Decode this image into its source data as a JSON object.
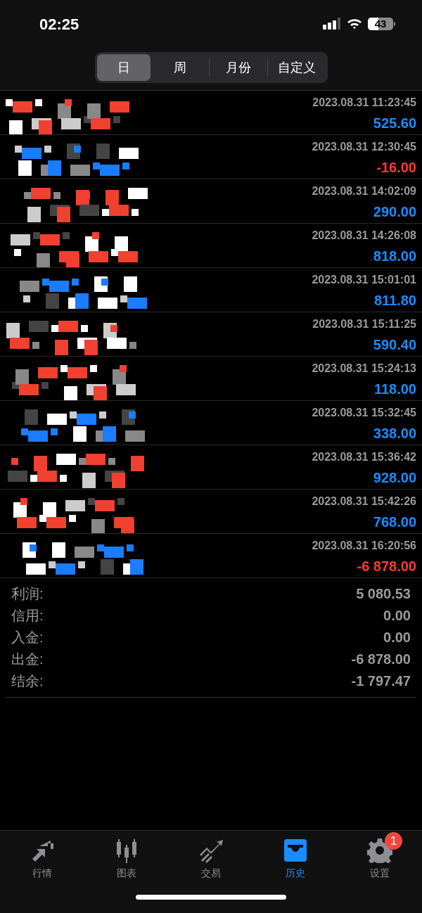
{
  "status_bar": {
    "time": "02:25",
    "battery": "43"
  },
  "tabs": [
    {
      "label": "日",
      "selected": true
    },
    {
      "label": "周",
      "selected": false
    },
    {
      "label": "月份",
      "selected": false
    },
    {
      "label": "自定义",
      "selected": false
    }
  ],
  "records": [
    {
      "time": "2023.08.31 11:23:45",
      "amount": "525.60",
      "color": "#1a8cff"
    },
    {
      "time": "2023.08.31 12:30:45",
      "amount": "-16.00",
      "color": "#ff3b30"
    },
    {
      "time": "2023.08.31 14:02:09",
      "amount": "290.00",
      "color": "#1a8cff"
    },
    {
      "time": "2023.08.31 14:26:08",
      "amount": "818.00",
      "color": "#1a8cff"
    },
    {
      "time": "2023.08.31 15:01:01",
      "amount": "811.80",
      "color": "#1a8cff"
    },
    {
      "time": "2023.08.31 15:11:25",
      "amount": "590.40",
      "color": "#1a8cff"
    },
    {
      "time": "2023.08.31 15:24:13",
      "amount": "118.00",
      "color": "#1a8cff"
    },
    {
      "time": "2023.08.31 15:32:45",
      "amount": "338.00",
      "color": "#1a8cff"
    },
    {
      "time": "2023.08.31 15:36:42",
      "amount": "928.00",
      "color": "#1a8cff"
    },
    {
      "time": "2023.08.31 15:42:26",
      "amount": "768.00",
      "color": "#1a8cff"
    },
    {
      "time": "2023.08.31 16:20:56",
      "amount": "-6 878.00",
      "color": "#ff3b30"
    }
  ],
  "summary": [
    {
      "label": "利润:",
      "value": "5 080.53"
    },
    {
      "label": "信用:",
      "value": "0.00"
    },
    {
      "label": "入金:",
      "value": "0.00"
    },
    {
      "label": "出金:",
      "value": "-6 878.00"
    },
    {
      "label": "结余:",
      "value": "-1 797.47"
    }
  ],
  "nav": [
    {
      "label": "行情",
      "kind": "quotes",
      "selected": false
    },
    {
      "label": "图表",
      "kind": "chart",
      "selected": false
    },
    {
      "label": "交易",
      "kind": "trade",
      "selected": false
    },
    {
      "label": "历史",
      "kind": "history",
      "selected": true
    },
    {
      "label": "设置",
      "kind": "settings",
      "selected": false,
      "badge": "1"
    }
  ]
}
